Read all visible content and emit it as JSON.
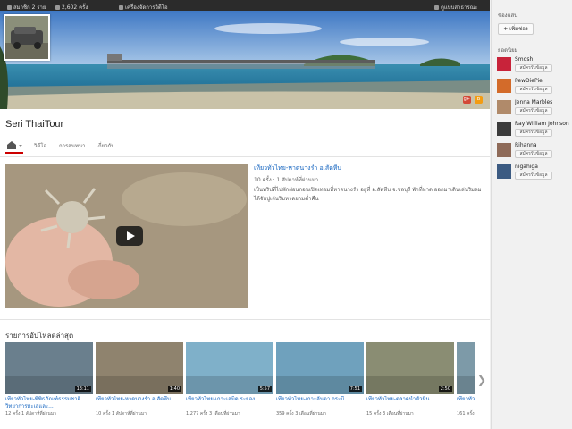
{
  "topbar": {
    "subscribers": "สมาชิก 2 ราย",
    "views": "2,602 ครั้ง",
    "video_manager": "เครื่องจัดการวิดีโอ",
    "public_view": "ดูแบบสาธารณะ"
  },
  "channel": {
    "title": "Seri ThaiTour"
  },
  "tabs": {
    "videos": "วิดีโอ",
    "discussion": "การสนทนา",
    "about": "เกี่ยวกับ"
  },
  "featured": {
    "title": "เที่ยวทั่วไทย-หาดนางรำ อ.สัตหีบ",
    "views": "10 ครั้ง",
    "age": "1 สัปดาห์ที่ผ่านมา",
    "description": "เป็นทริปที่ไปพักผ่อนกอนเปิดเทอมที่หาดนางรำ อยู่ที่ อ.สัตหีบ จ.ชลบุรี พักที่หาด ออกมาเดินเล่นริมลม ได้จับปูเล่นริมหาดยามค่ำคืน"
  },
  "uploads": {
    "title": "รายการอัปโหลดล่าสุด",
    "items": [
      {
        "title": "เที่ยวทั่วไทย-พิพิธภัณฑ์ธรรมชาติวิทยาการทะเลและ...",
        "views": "12 ครั้ง",
        "age": "1 สัปดาห์ที่ผ่านมา",
        "duration": "13:11",
        "color": "#6a7f8d"
      },
      {
        "title": "เที่ยวทั่วไทย-หาดนางรำ อ.สัตหีบ",
        "views": "10 ครั้ง",
        "age": "1 สัปดาห์ที่ผ่านมา",
        "duration": "1:40",
        "color": "#8f836e"
      },
      {
        "title": "เที่ยวทั่วไทย-เกาะเสม็ด ระยอง",
        "views": "1,277 ครั้ง",
        "age": "3 เดือนที่ผ่านมา",
        "duration": "5:57",
        "color": "#7fb0c9"
      },
      {
        "title": "เที่ยวทั่วไทย-เกาะลันตา กระบี่",
        "views": "359 ครั้ง",
        "age": "3 เดือนที่ผ่านมา",
        "duration": "7:51",
        "color": "#6fa1bd"
      },
      {
        "title": "เที่ยวทั่วไทย-ตลาดน้ำหัวหิน",
        "views": "15 ครั้ง",
        "age": "3 เดือนที่ผ่านมา",
        "duration": "2:50",
        "color": "#8a8d73"
      },
      {
        "title": "เที่ยวทั่วไทย-",
        "views": "161 ครั้ง",
        "age": "",
        "duration": "",
        "color": "#7d9aa8"
      }
    ]
  },
  "sidebar": {
    "header": "ช่องแสน",
    "add_button": "+ เพิ่มช่อง",
    "rec_header": "ยอดนิยม",
    "subscribe_label": "สมัครรับข้อมูล",
    "channels": [
      {
        "name": "Smosh",
        "color": "#c8233a"
      },
      {
        "name": "PewDiePie",
        "color": "#d36b2a"
      },
      {
        "name": "Jenna Marbles",
        "color": "#b08a6a"
      },
      {
        "name": "Ray William Johnson",
        "color": "#3b3b3b"
      },
      {
        "name": "Rihanna",
        "color": "#8e6a58"
      },
      {
        "name": "nigahiga",
        "color": "#3c5b82"
      }
    ]
  }
}
